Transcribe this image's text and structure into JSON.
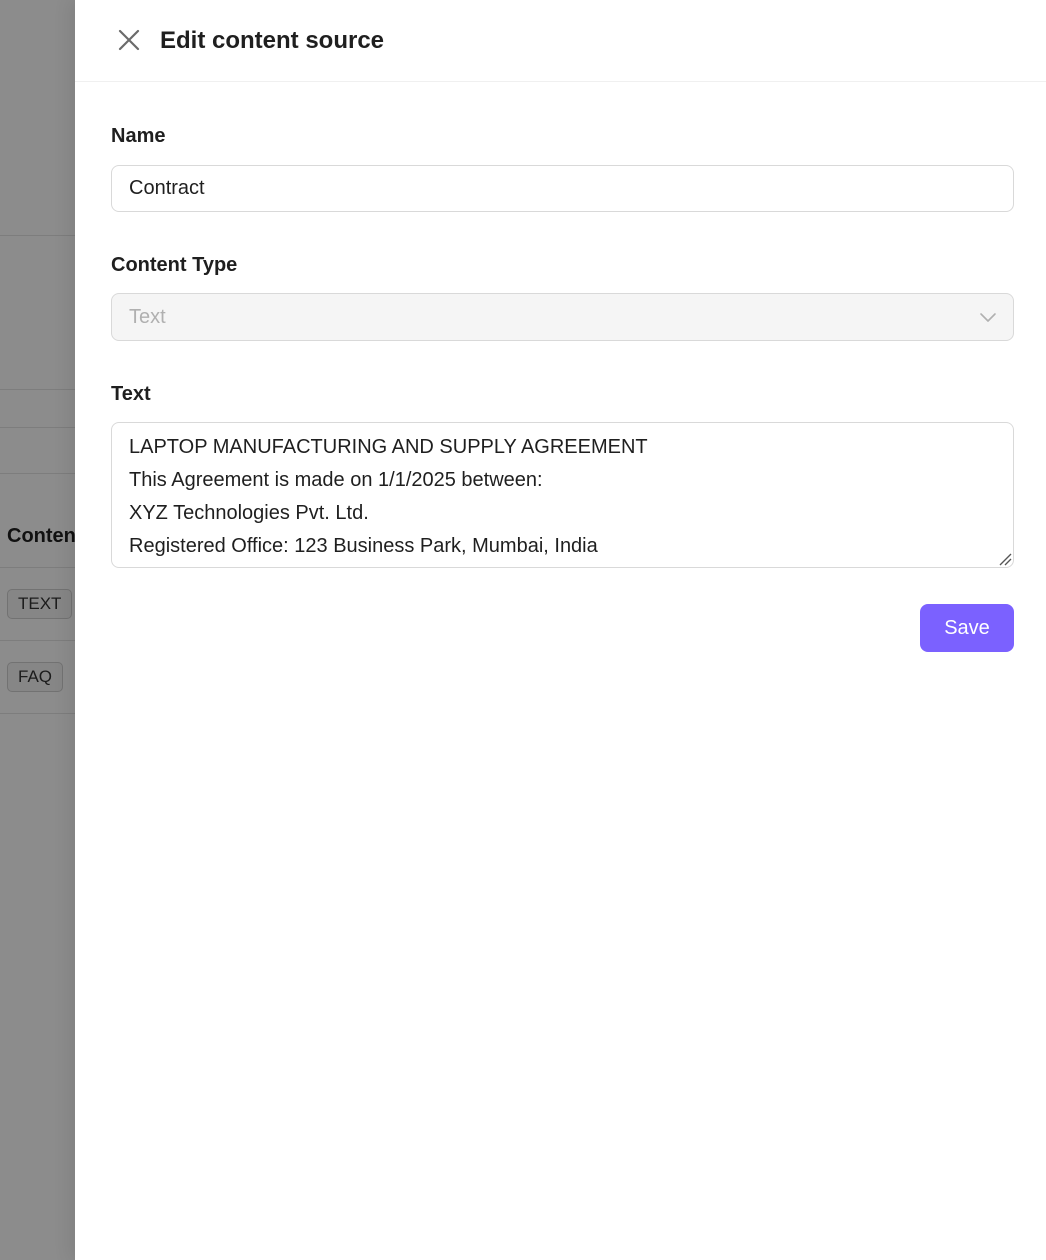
{
  "background": {
    "column_header": "Conten",
    "tags": [
      "TEXT",
      "FAQ"
    ]
  },
  "drawer": {
    "title": "Edit content source",
    "name_field": {
      "label": "Name",
      "value": "Contract"
    },
    "content_type_field": {
      "label": "Content Type",
      "value": "Text",
      "disabled": true
    },
    "text_field": {
      "label": "Text",
      "value": "LAPTOP MANUFACTURING AND SUPPLY AGREEMENT\nThis Agreement is made on 1/1/2025 between:\nXYZ Technologies Pvt. Ltd.\nRegistered Office: 123 Business Park, Mumbai, India"
    },
    "save_label": "Save"
  },
  "colors": {
    "primary": "#7b61ff",
    "mask": "#8c8c8c"
  },
  "icons": {
    "close": "close-icon",
    "select_arrow": "chevron-down-icon",
    "resize": "resize-handle-icon"
  }
}
